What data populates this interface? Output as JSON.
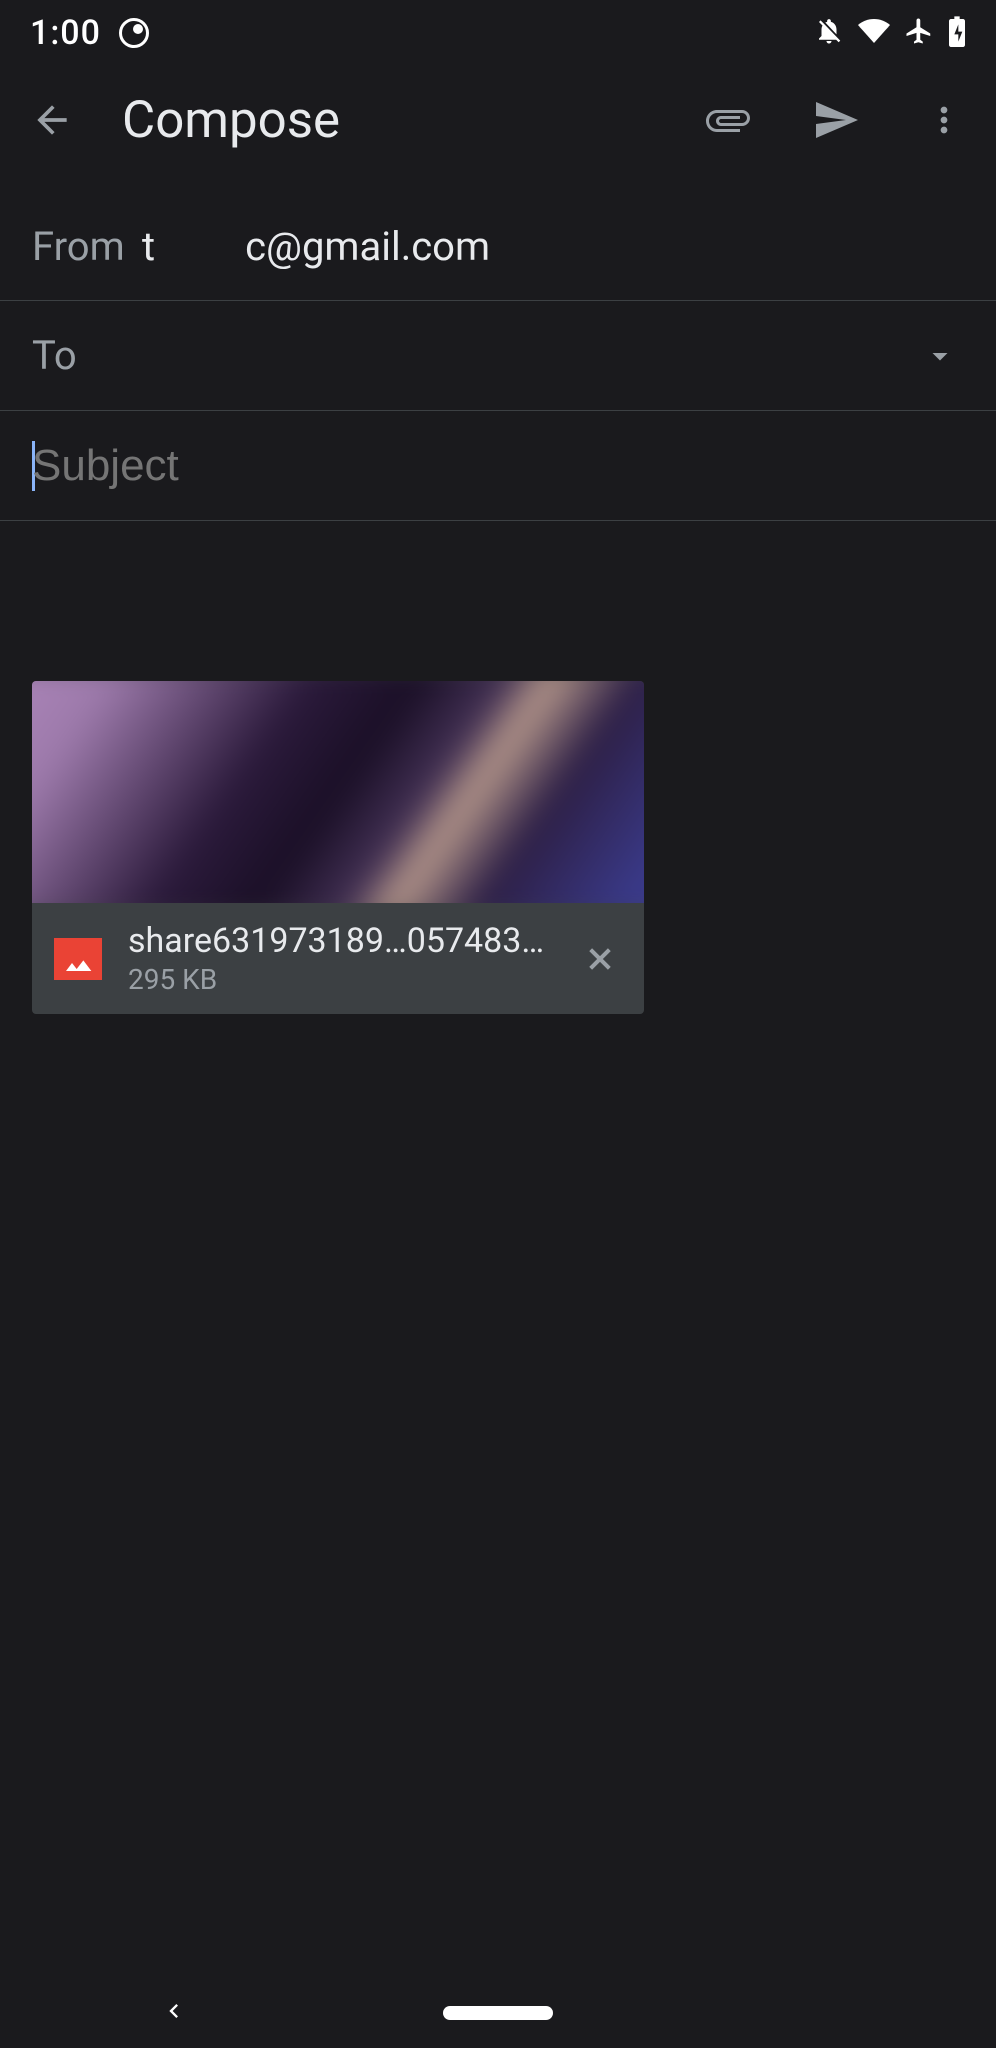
{
  "status": {
    "time": "1:00"
  },
  "appbar": {
    "title": "Compose"
  },
  "from": {
    "label": "From",
    "part1": "t",
    "part2": "c@gmail.com"
  },
  "to": {
    "label": "To"
  },
  "subject": {
    "placeholder": "Subject"
  },
  "attachment": {
    "name": "share631973189…05748371.png",
    "size": "295 KB"
  }
}
